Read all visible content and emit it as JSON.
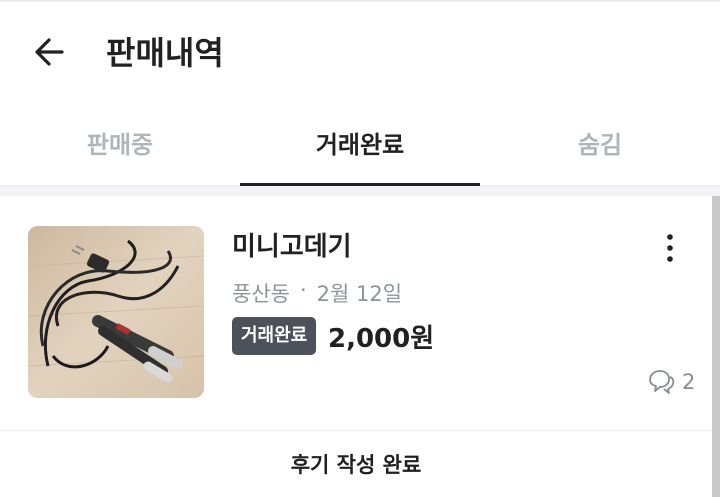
{
  "header": {
    "title": "판매내역",
    "back_icon": "arrow-left-icon"
  },
  "tabs": [
    {
      "label": "판매중",
      "active": false
    },
    {
      "label": "거래완료",
      "active": true
    },
    {
      "label": "숨김",
      "active": false
    }
  ],
  "item": {
    "title": "미니고데기",
    "location": "풍산동",
    "separator": "·",
    "date": "2월 12일",
    "status": "거래완료",
    "price": "2,000원",
    "chat_count": "2",
    "more_icon": "more-vertical-icon",
    "chat_icon": "chat-bubbles-icon",
    "image": "hair-straightener-photo"
  },
  "review_button": "후기 작성 완료",
  "colors": {
    "text": "#212124",
    "inactive_tab": "#adb5bd",
    "meta": "#8e949b",
    "badge_bg": "#4d5159",
    "section_gap": "#f2f3f6"
  }
}
